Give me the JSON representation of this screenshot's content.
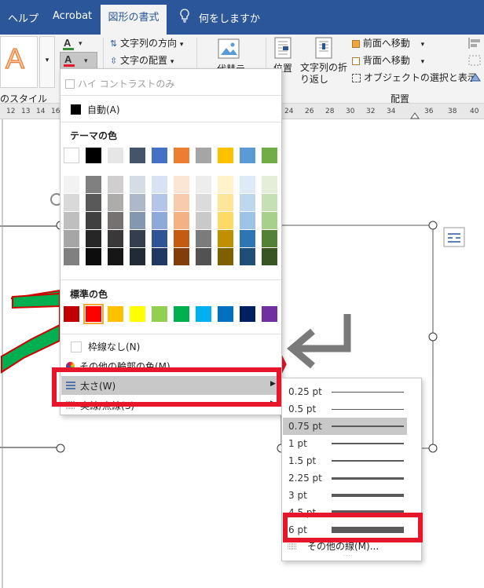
{
  "tabs": {
    "help": "ヘルプ",
    "acrobat": "Acrobat",
    "shape_format": "図形の書式",
    "tell_me": "何をしますか"
  },
  "ribbon": {
    "style_label": "のスタイル",
    "text_direction": "文字列の方向",
    "text_align": "文字の配置",
    "alt_text": "代替テ",
    "position": "位置",
    "wrap_text": "文字列の折り返し",
    "bring_forward": "前面へ移動",
    "send_backward": "背面へ移動",
    "selection_pane": "オブジェクトの選択と表示",
    "arrange_label": "配置"
  },
  "ruler_ticks": [
    "12",
    "13",
    "14",
    "16",
    "24",
    "26",
    "28",
    "30",
    "32",
    "34",
    "36",
    "38",
    "40"
  ],
  "menu": {
    "high_contrast": "ハイ コントラストのみ",
    "automatic": "自動(A)",
    "theme_colors_header": "テーマの色",
    "standard_colors_header": "標準の色",
    "no_outline": "枠線なし(N)",
    "more_outline_colors": "その他の輪郭の色(M)...",
    "weight": "太さ(W)",
    "dashes": "実線/点線(S)"
  },
  "theme_colors": {
    "top": [
      "#ffffff",
      "#000000",
      "#e7e6e6",
      "#44546a",
      "#4472c4",
      "#ed7d31",
      "#a5a5a5",
      "#ffc000",
      "#5b9bd5",
      "#70ad47"
    ],
    "shades": [
      [
        "#f2f2f2",
        "#d9d9d9",
        "#bfbfbf",
        "#a6a6a6",
        "#808080"
      ],
      [
        "#808080",
        "#595959",
        "#404040",
        "#262626",
        "#0d0d0d"
      ],
      [
        "#d0cece",
        "#aeabab",
        "#757171",
        "#3a3838",
        "#171616"
      ],
      [
        "#d6dce4",
        "#adb9ca",
        "#8497b0",
        "#333f4f",
        "#222a35"
      ],
      [
        "#d9e2f3",
        "#b4c6e7",
        "#8eaadb",
        "#2f5496",
        "#1f3864"
      ],
      [
        "#fbe5d5",
        "#f7cbac",
        "#f4b183",
        "#c55a11",
        "#843c0b"
      ],
      [
        "#ededed",
        "#dbdbdb",
        "#c9c9c9",
        "#7b7b7b",
        "#525252"
      ],
      [
        "#fff2cc",
        "#fee599",
        "#ffd966",
        "#bf9000",
        "#7f6000"
      ],
      [
        "#deebf6",
        "#bdd7ee",
        "#9dc3e6",
        "#2e75b5",
        "#1f4e79"
      ],
      [
        "#e2efd9",
        "#c5e0b3",
        "#a8d08d",
        "#538135",
        "#375623"
      ]
    ]
  },
  "standard_colors": [
    "#c00000",
    "#ff0000",
    "#ffc000",
    "#ffff00",
    "#92d050",
    "#00b050",
    "#00b0f0",
    "#0070c0",
    "#002060",
    "#7030a0"
  ],
  "weights": [
    "0.25 pt",
    "0.5 pt",
    "0.75 pt",
    "1 pt",
    "1.5 pt",
    "2.25 pt",
    "3 pt",
    "4.5 pt",
    "6 pt"
  ],
  "submenu_more": "その他の線(M)...",
  "colors": {
    "accent": "#2b579a",
    "highlight_red": "#e8162a",
    "selected_row": "#c8c8c8"
  }
}
